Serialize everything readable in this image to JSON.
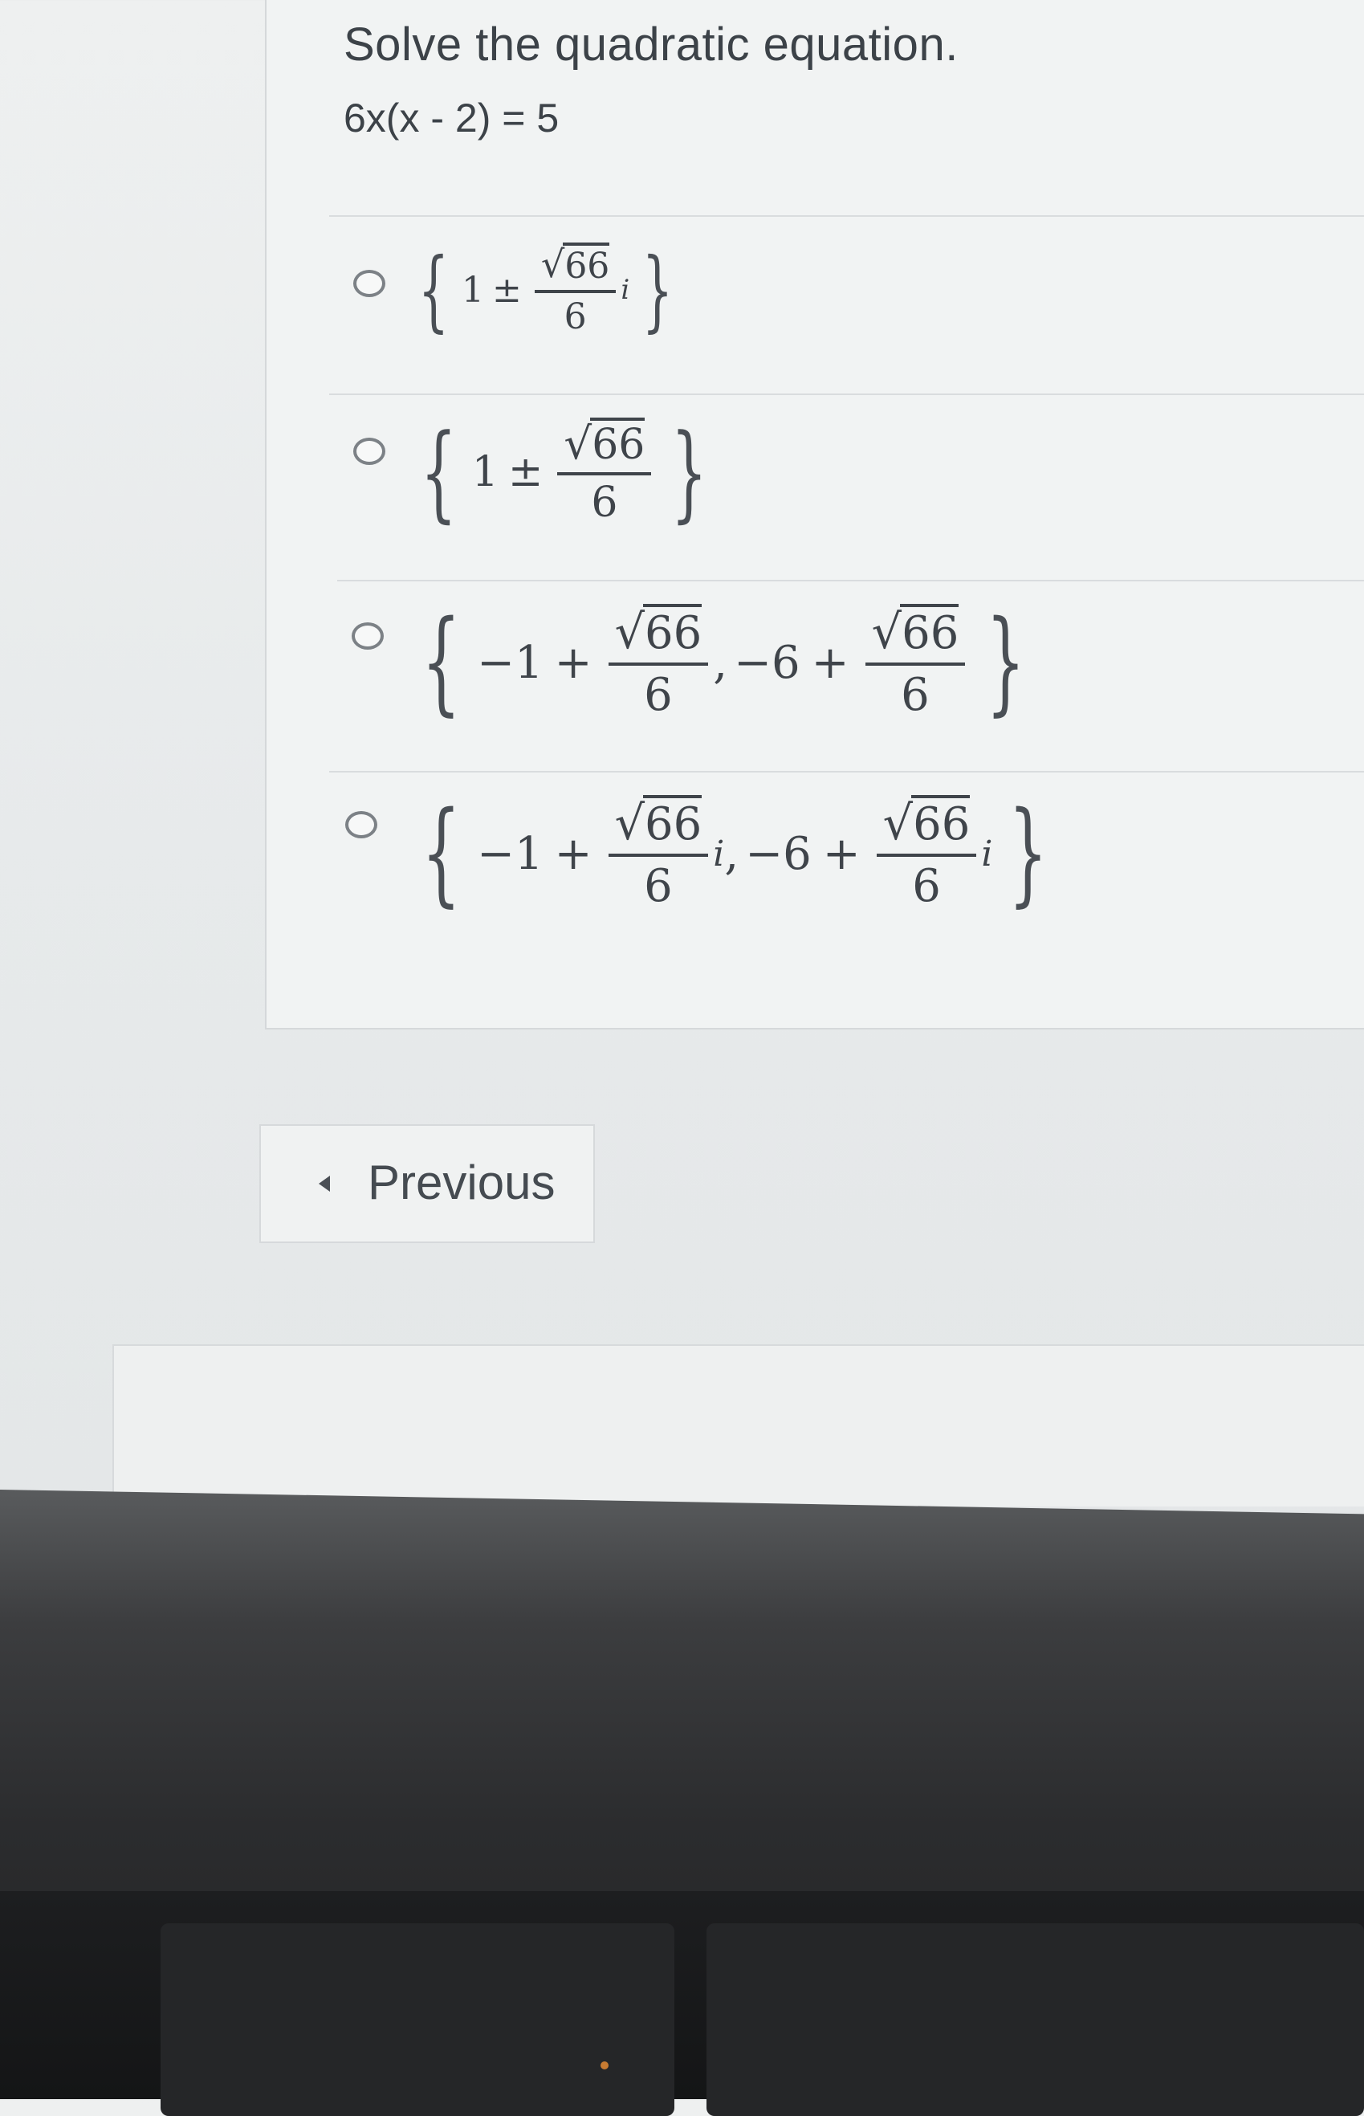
{
  "question": {
    "title": "Solve the quadratic equation.",
    "equation": "6x(x - 2) = 5"
  },
  "options": [
    {
      "id": "a",
      "text": "{1 ± √66/6 i}",
      "selected": false
    },
    {
      "id": "b",
      "text": "{1 ± √66/6}",
      "selected": false
    },
    {
      "id": "c",
      "text": "{−1 + √66/6, −6 + √66/6}",
      "selected": false
    },
    {
      "id": "d",
      "text": "{−1 + √66/6 i, −6 + √66/6 i}",
      "selected": false
    }
  ],
  "math": {
    "one": "1",
    "pm": "±",
    "neg_one": "−1",
    "plus": "+",
    "neg_six": "−6",
    "radicand": "66",
    "denominator": "6",
    "imag": "i",
    "comma": ",",
    "sqrt": "√"
  },
  "navigation": {
    "previous_label": "Previous"
  },
  "icons": {
    "radio": "radio-unselected-icon",
    "previous": "caret-left-icon"
  },
  "colors": {
    "page_bg": "#eef0f0",
    "text": "#3c4248",
    "divider": "#d9dcde"
  }
}
